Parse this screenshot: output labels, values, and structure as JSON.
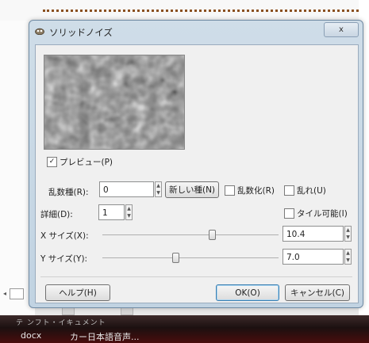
{
  "dialog": {
    "title": "ソリッドノイズ",
    "close_label": "x"
  },
  "preview": {
    "checkbox_checked_mark": "✓",
    "label": "プレビュー(P)",
    "checked": true
  },
  "seed": {
    "label": "乱数種(R):",
    "value": "0",
    "new_seed_button": "新しい種(N)",
    "randomize_label": "乱数化(R)"
  },
  "turbulent": {
    "label": "乱れ(U)"
  },
  "detail": {
    "label": "詳細(D):",
    "value": "1"
  },
  "tileable": {
    "label": "タイル可能(I)"
  },
  "x_size": {
    "label": "X サイズ(X):",
    "value": "10.4",
    "level": 0.65
  },
  "y_size": {
    "label": "Y サイズ(Y):",
    "value": "7.0",
    "level": 0.44
  },
  "buttons": {
    "help": "ヘルプ(H)",
    "ok": "OK(O)",
    "cancel": "キャンセル(C)"
  },
  "taskbar": {
    "faded_text": "テ ンフト・イキュメント",
    "item1": "docx",
    "item2": "カー日本語音声..."
  },
  "spinner": {
    "up": "▲",
    "down": "▼"
  },
  "left_arrow": "◂"
}
